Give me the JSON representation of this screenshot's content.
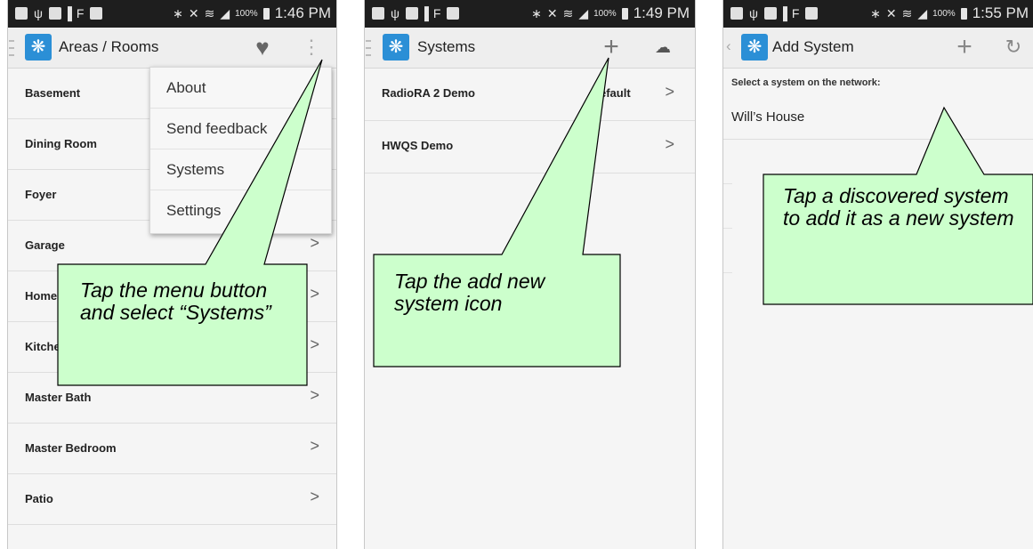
{
  "status_bar": {
    "panel1_time": "1:46 PM",
    "panel2_time": "1:49 PM",
    "panel3_time": "1:55 PM",
    "battery_label": "100%"
  },
  "panel1": {
    "title": "Areas / Rooms",
    "rooms": [
      "Basement",
      "Dining Room",
      "Foyer",
      "Garage",
      "Home",
      "Kitche",
      "Master Bath",
      "Master Bedroom",
      "Patio"
    ],
    "menu_items": [
      "About",
      "Send feedback",
      "Systems",
      "Settings"
    ],
    "callout": "Tap the menu button and select “Systems”"
  },
  "panel2": {
    "title": "Systems",
    "systems": [
      {
        "name": "RadioRA 2 Demo",
        "tag": "efault"
      },
      {
        "name": "HWQS Demo",
        "tag": ""
      }
    ],
    "callout": "Tap the add new system icon"
  },
  "panel3": {
    "title": "Add System",
    "section_label": "Select a system on the network:",
    "discovered": "Will’s House",
    "callout": "Tap a discovered system to add it as a new system"
  },
  "icons": {
    "heart": "heart-icon",
    "overflow": "overflow-menu-icon",
    "add": "plus-icon",
    "cloud": "cloud-icon",
    "refresh": "refresh-icon",
    "chevron": "chevron-right-icon"
  },
  "colors": {
    "callout_fill": "#ccffcc",
    "app_logo": "#2b8fd6",
    "status_bar": "#1e1e1e"
  }
}
